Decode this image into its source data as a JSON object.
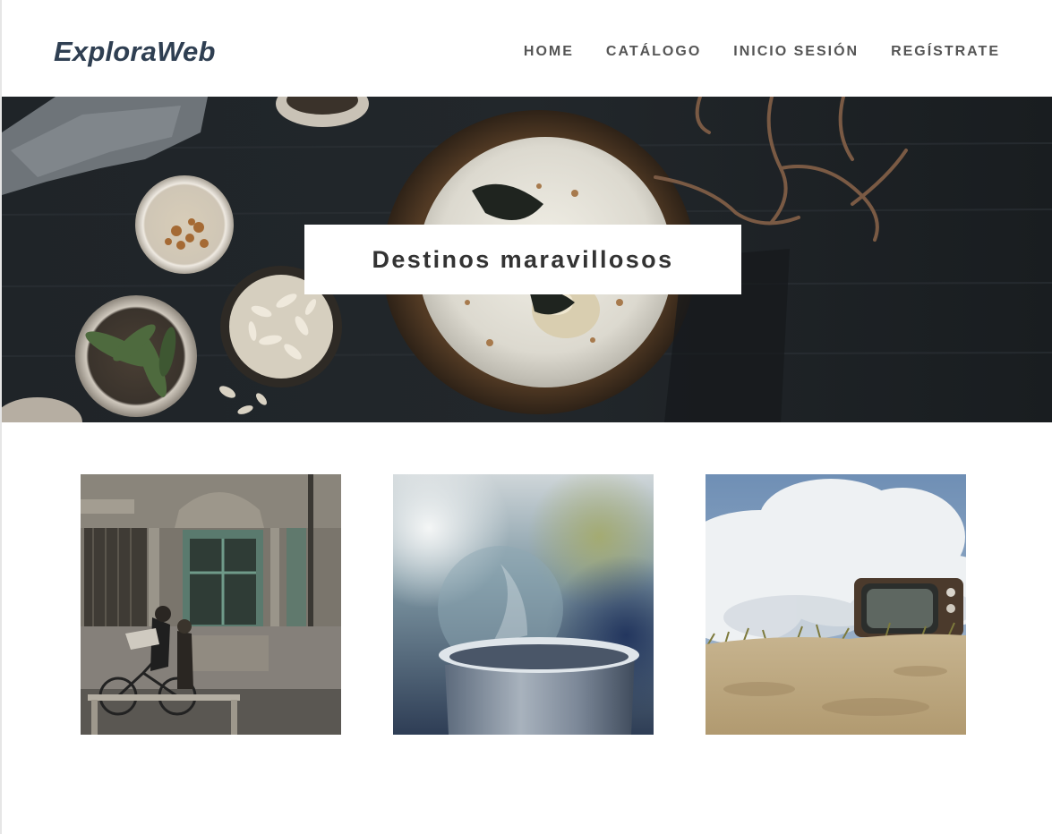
{
  "header": {
    "brand": "ExploraWeb",
    "nav": [
      {
        "label": "HOME"
      },
      {
        "label": "CATÁLOGO"
      },
      {
        "label": "INICIO SESIÓN"
      },
      {
        "label": "REGÍSTRATE"
      }
    ]
  },
  "hero": {
    "title": "Destinos maravillosos"
  },
  "colors": {
    "brand": "#2f3f52",
    "nav_text": "#555555",
    "hero_title": "#333333",
    "hero_background": "#1d2125"
  }
}
